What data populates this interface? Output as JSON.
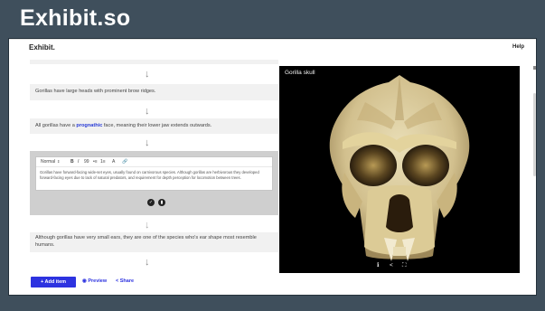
{
  "banner": {
    "title": "Exhibit.so"
  },
  "app": {
    "logo": "Exhibit.",
    "help": "Help"
  },
  "items": [
    {
      "text": "Gorillas have large heads with prominent brow ridges."
    },
    {
      "text_before": "All gorillas have a ",
      "emphasis": "prognathic",
      "text_after": " face, meaning their lower jaw extends outwards."
    },
    {
      "editing": true,
      "text": "Gorillas have forward-facing wide-set eyes, usually found on carnivorous species. Although gorillas are herbivorous they developed forward-facing eyes due to lack of natural predators, and requirement for depth perception for locomotion between trees."
    },
    {
      "text": "Although gorillas have very small ears, they are one of the species who's ear shape most resemble humans."
    }
  ],
  "arrow_icon": "↓",
  "editor": {
    "style_select": "Normal",
    "tools": [
      "B",
      "I",
      "99",
      "•≡",
      "1≡",
      "A",
      "🔗"
    ],
    "confirm_icon": "check-circle-icon",
    "delete_icon": "trash-icon"
  },
  "actions": {
    "add": "+ Add item",
    "preview": "Preview",
    "share": "Share"
  },
  "viewer": {
    "title": "Gorilla skull"
  },
  "colors": {
    "accent": "#2d33e0",
    "banner": "#3f4f5c"
  }
}
